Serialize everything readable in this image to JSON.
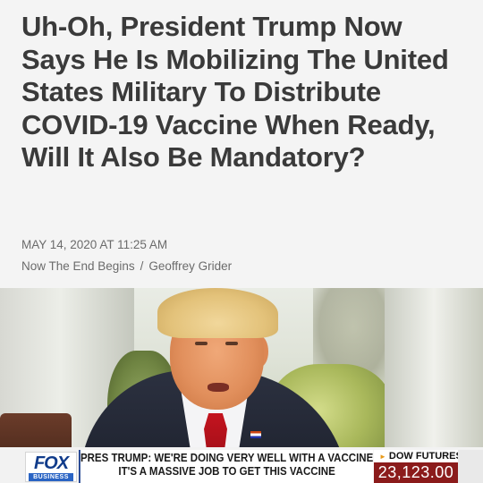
{
  "article": {
    "headline": "Uh-Oh, President Trump Now Says He Is Mobilizing The United States Military To Distribute COVID-19 Vaccine When Ready, Will It Also Be Mandatory?",
    "date": "MAY 14, 2020 AT 11:25 AM",
    "byline_site": "Now The End Begins",
    "byline_separator": "/",
    "byline_author": "Geoffrey Grider"
  },
  "video": {
    "network_logo": "FOX",
    "network_sublabel": "BUSINESS",
    "chyron_line1": "PRES TRUMP: WE'RE DOING VERY WELL WITH A VACCINE",
    "chyron_line2": "IT'S A MASSIVE JOB TO GET THIS VACCINE",
    "ticker_label": "DOW FUTURES",
    "ticker_value": "23,123.00",
    "colors": {
      "fox_blue": "#103b8a",
      "ticker_red": "#8b1b1b",
      "headline_text": "#3a3a3a"
    }
  }
}
